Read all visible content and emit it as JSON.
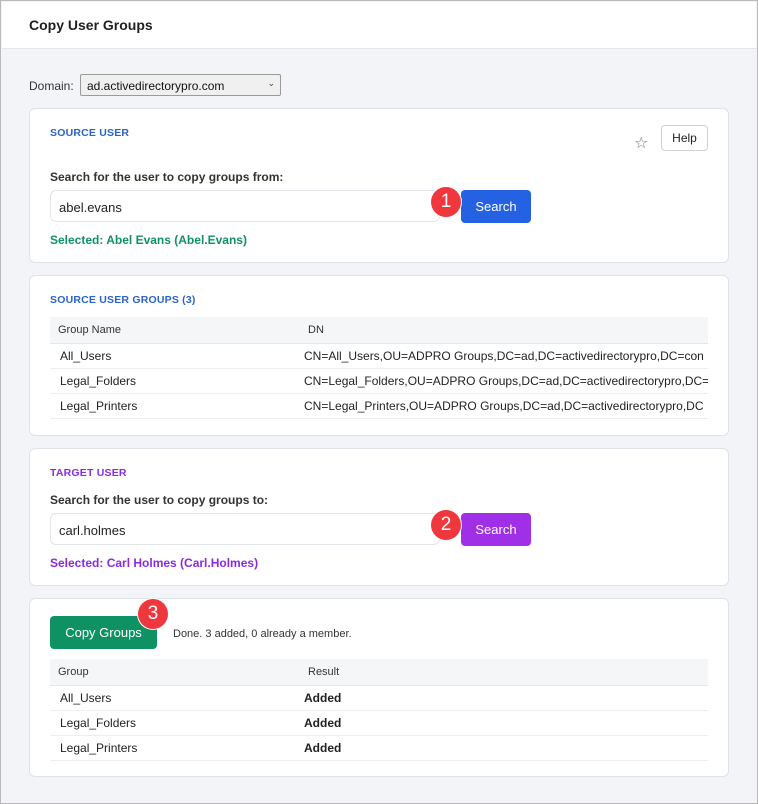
{
  "window": {
    "title": "Copy User Groups"
  },
  "domain": {
    "label": "Domain:",
    "value": "ad.activedirectorypro.com"
  },
  "source_user": {
    "section_title": "SOURCE USER",
    "help_label": "Help",
    "search_label": "Search for the user to copy groups from:",
    "search_value": "abel.evans",
    "search_button": "Search",
    "selected_text": "Selected: Abel Evans (Abel.Evans)",
    "step": "1"
  },
  "source_groups": {
    "section_title": "SOURCE USER GROUPS (3)",
    "columns": [
      "Group Name",
      "DN"
    ],
    "rows": [
      {
        "name": "All_Users",
        "dn": "CN=All_Users,OU=ADPRO Groups,DC=ad,DC=activedirectorypro,DC=con"
      },
      {
        "name": "Legal_Folders",
        "dn": "CN=Legal_Folders,OU=ADPRO Groups,DC=ad,DC=activedirectorypro,DC="
      },
      {
        "name": "Legal_Printers",
        "dn": "CN=Legal_Printers,OU=ADPRO Groups,DC=ad,DC=activedirectorypro,DC"
      }
    ]
  },
  "target_user": {
    "section_title": "TARGET USER",
    "search_label": "Search for the user to copy groups to:",
    "search_value": "carl.holmes",
    "search_button": "Search",
    "selected_text": "Selected: Carl Holmes (Carl.Holmes)",
    "step": "2"
  },
  "copy": {
    "button": "Copy Groups",
    "step": "3",
    "status": "Done. 3 added, 0 already a member.",
    "columns": [
      "Group",
      "Result"
    ],
    "rows": [
      {
        "group": "All_Users",
        "result": "Added"
      },
      {
        "group": "Legal_Folders",
        "result": "Added"
      },
      {
        "group": "Legal_Printers",
        "result": "Added"
      }
    ]
  },
  "colors": {
    "accent_blue": "#2462e3",
    "accent_purple": "#9f30e8",
    "accent_green": "#0e9163",
    "badge_red": "#f0373d"
  },
  "icons": {
    "favorite": "star-icon",
    "dropdown": "chevron-down-icon"
  }
}
